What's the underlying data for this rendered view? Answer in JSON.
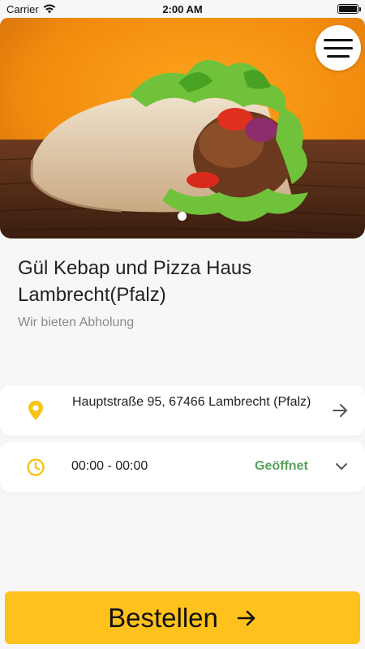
{
  "status_bar": {
    "carrier": "Carrier",
    "time": "2:00 AM",
    "battery_level": 1.0
  },
  "hero": {
    "image_description_icon": "kebab-wrap-photo",
    "page_count": 1,
    "active_page": 0
  },
  "menu": {
    "icon": "hamburger-menu-icon"
  },
  "restaurant": {
    "name": "Gül Kebap und Pizza Haus Lambrecht(Pfalz)",
    "tagline": "Wir bieten Abholung"
  },
  "address": {
    "text": "Hauptstraße 95, 67466 Lambrecht (Pfalz)",
    "icon": "location-pin-icon"
  },
  "hours": {
    "text": "00:00 - 00:00",
    "status": "Geöffnet",
    "icon": "clock-icon"
  },
  "order_button": {
    "label": "Bestellen"
  },
  "colors": {
    "accent": "#ffc21c",
    "open_status": "#55a35e",
    "icon_yellow": "#f5c518"
  }
}
